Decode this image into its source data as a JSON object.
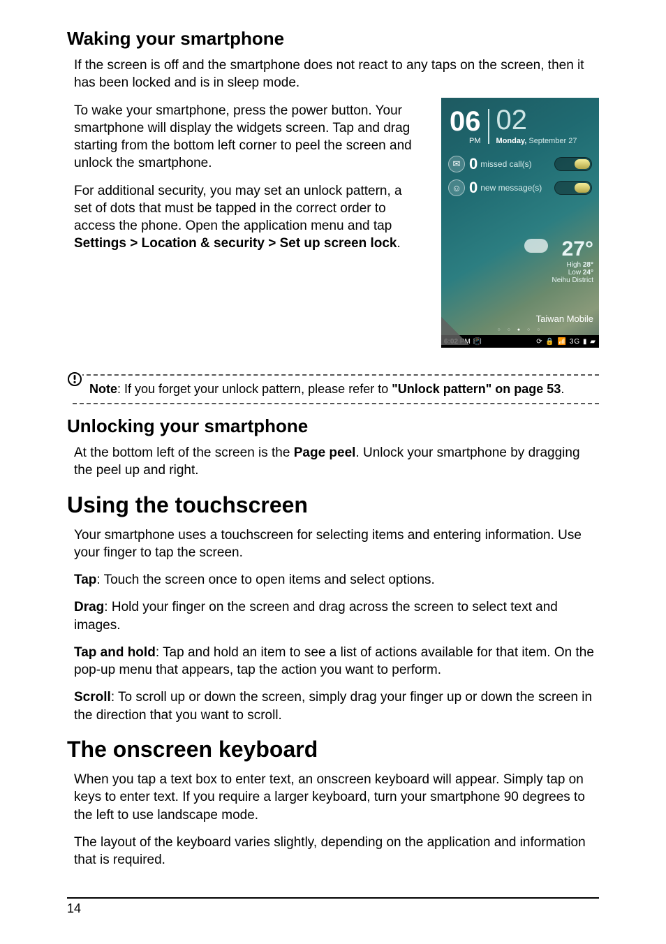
{
  "page_number": "14",
  "s1": {
    "heading": "Waking your smartphone",
    "p1": "If the screen is off and the smartphone does not react to any taps on the screen, then it has been locked and is in sleep mode.",
    "p2": "To wake your smartphone, press the power button. Your smartphone will display the widgets screen. Tap and drag starting from the bottom left corner to peel the screen and unlock the smartphone.",
    "p3a": "For additional security, you may set an unlock pattern, a set of dots that must be tapped in the correct order to access the phone. Open the application menu and tap ",
    "p3b": "Settings > Location & security > Set up screen lock",
    "p3c": "."
  },
  "note": {
    "label": "Note",
    "body": ": If you forget your unlock pattern, please refer to ",
    "link": "\"Unlock pattern\" on page 53",
    "tail": "."
  },
  "s2": {
    "heading": "Unlocking your smartphone",
    "p1a": "At the bottom left of the screen is the ",
    "p1b": "Page peel",
    "p1c": ". Unlock your smartphone by dragging the peel up and right."
  },
  "s3": {
    "heading": "Using the touchscreen",
    "p1": "Your smartphone uses a touchscreen for selecting items and entering information. Use your finger to tap the screen.",
    "p2a": "Tap",
    "p2b": ": Touch the screen once to open items and select options.",
    "p3a": "Drag",
    "p3b": ": Hold your finger on the screen and drag across the screen to select text and images.",
    "p4a": "Tap and hold",
    "p4b": ": Tap and hold an item to see a list of actions available for that item. On the pop-up menu that appears, tap the action you want to perform.",
    "p5a": "Scroll",
    "p5b": ": To scroll up or down the screen, simply drag your finger up or down the screen in the direction that you want to scroll."
  },
  "s4": {
    "heading": "The onscreen keyboard",
    "p1": "When you tap a text box to enter text, an onscreen keyboard will appear. Simply tap on keys to enter text. If you require a larger keyboard, turn your smartphone 90 degrees to the left to use landscape mode.",
    "p2": "The layout of the keyboard varies slightly, depending on the application and information that is required."
  },
  "phone": {
    "hour": "06",
    "ampm": "PM",
    "minute": "02",
    "day": "Monday,",
    "date_rest": " September 27",
    "missed_count": "0",
    "missed_label": "missed call(s)",
    "msg_count": "0",
    "msg_label": "new message(s)",
    "temp": "27°",
    "high_lbl": "High ",
    "high_val": "28°",
    "low_lbl": "Low ",
    "low_val": "24°",
    "district": "Neihu District",
    "carrier": "Taiwan Mobile",
    "clock": "6:02",
    "clock_pm": " PM",
    "net": "3G"
  }
}
